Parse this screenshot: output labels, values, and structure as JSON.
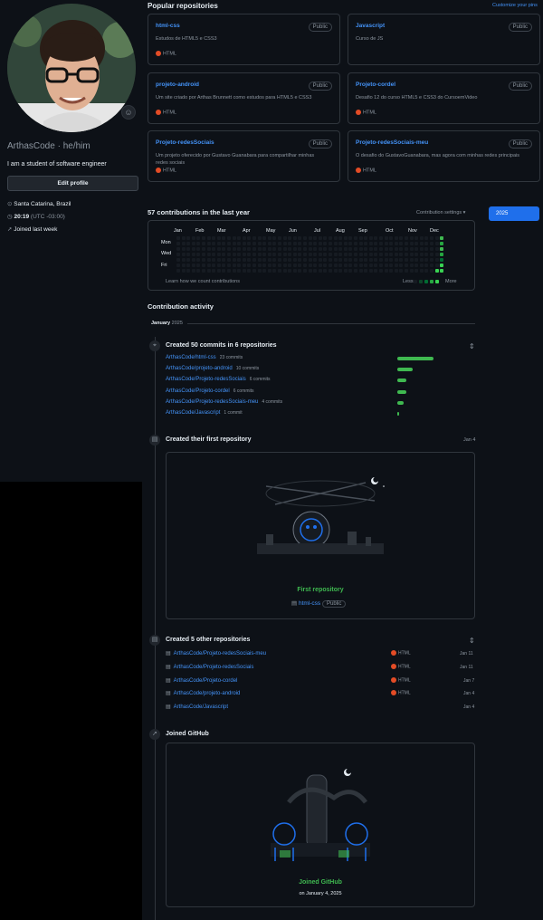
{
  "profile": {
    "username": "ArthasCode",
    "pronouns": "he/him",
    "bio": "I am a student of software engineer",
    "edit_button": "Edit profile",
    "location": "Santa Catarina, Brazil",
    "time": "20:19",
    "timezone": "(UTC -03:00)",
    "joined": "Joined last week"
  },
  "popular": {
    "title": "Popular repositories",
    "customize": "Customize your pins",
    "repos": [
      {
        "name": "html-css",
        "desc": "Estudos de HTML5 e CSS3",
        "visibility": "Public",
        "lang": "HTML"
      },
      {
        "name": "Javascript",
        "desc": "Curso de JS",
        "visibility": "Public",
        "lang": ""
      },
      {
        "name": "projeto-android",
        "desc": "Um site criado por Arthas Brunnett como estudos para HTML5 e CSS3",
        "visibility": "Public",
        "lang": "HTML"
      },
      {
        "name": "Projeto-cordel",
        "desc": "Desafio 12 do curso HTML5 e CSS3 do CursoemVideo",
        "visibility": "Public",
        "lang": "HTML"
      },
      {
        "name": "Projeto-redesSociais",
        "desc": "Um projeto oferecido por Gustavo Guanabara para compartilhar minhas redes sociais",
        "visibility": "Public",
        "lang": "HTML"
      },
      {
        "name": "Projeto-redesSociais-meu",
        "desc": "O desafio do GustavoGuanabara, mas agora com minhas redes principais",
        "visibility": "Public",
        "lang": "HTML"
      }
    ]
  },
  "contrib": {
    "title": "57 contributions in the last year",
    "settings": "Contribution settings",
    "year": "2025",
    "months": [
      "Jan",
      "Feb",
      "Mar",
      "Apr",
      "May",
      "Jun",
      "Jul",
      "Aug",
      "Sep",
      "Oct",
      "Nov",
      "Dec"
    ],
    "days": [
      "Mon",
      "Wed",
      "Fri"
    ],
    "learn": "Learn how we count contributions",
    "less": "Less",
    "more": "More"
  },
  "activity": {
    "title": "Contribution activity",
    "month": "January",
    "month_year": "2025",
    "commits_title": "Created 50 commits in 6 repositories",
    "commits": [
      {
        "repo": "ArthasCode/html-css",
        "count": "23 commits",
        "value": 23
      },
      {
        "repo": "ArthasCode/projeto-android",
        "count": "10 commits",
        "value": 10
      },
      {
        "repo": "ArthasCode/Projeto-redesSociais",
        "count": "6 commits",
        "value": 6
      },
      {
        "repo": "ArthasCode/Projeto-cordel",
        "count": "6 commits",
        "value": 6
      },
      {
        "repo": "ArthasCode/Projeto-redesSociais-meu",
        "count": "4 commits",
        "value": 4
      },
      {
        "repo": "ArthasCode/Javascript",
        "count": "1 commit",
        "value": 1
      }
    ],
    "first_repo_title": "Created their first repository",
    "first_repo_date": "Jan 4",
    "first_repo_label": "First repository",
    "first_repo_name": "html-css",
    "first_repo_vis": "Public",
    "other_title": "Created 5 other repositories",
    "others": [
      {
        "repo": "ArthasCode/Projeto-redesSociais-meu",
        "lang": "HTML",
        "date": "Jan 11"
      },
      {
        "repo": "ArthasCode/Projeto-redesSociais",
        "lang": "HTML",
        "date": "Jan 11"
      },
      {
        "repo": "ArthasCode/Projeto-cordel",
        "lang": "HTML",
        "date": "Jan 7"
      },
      {
        "repo": "ArthasCode/projeto-android",
        "lang": "HTML",
        "date": "Jan 4"
      },
      {
        "repo": "ArthasCode/Javascript",
        "lang": "",
        "date": "Jan 4"
      }
    ],
    "joined_title": "Joined GitHub",
    "joined_label": "Joined GitHub",
    "joined_date": "on January 4, 2025"
  },
  "colors": {
    "bg": "#0d1117",
    "border": "#30363d",
    "link": "#4493f8",
    "green": "#3fb950",
    "html": "#e34c26",
    "primary": "#1f6feb"
  }
}
